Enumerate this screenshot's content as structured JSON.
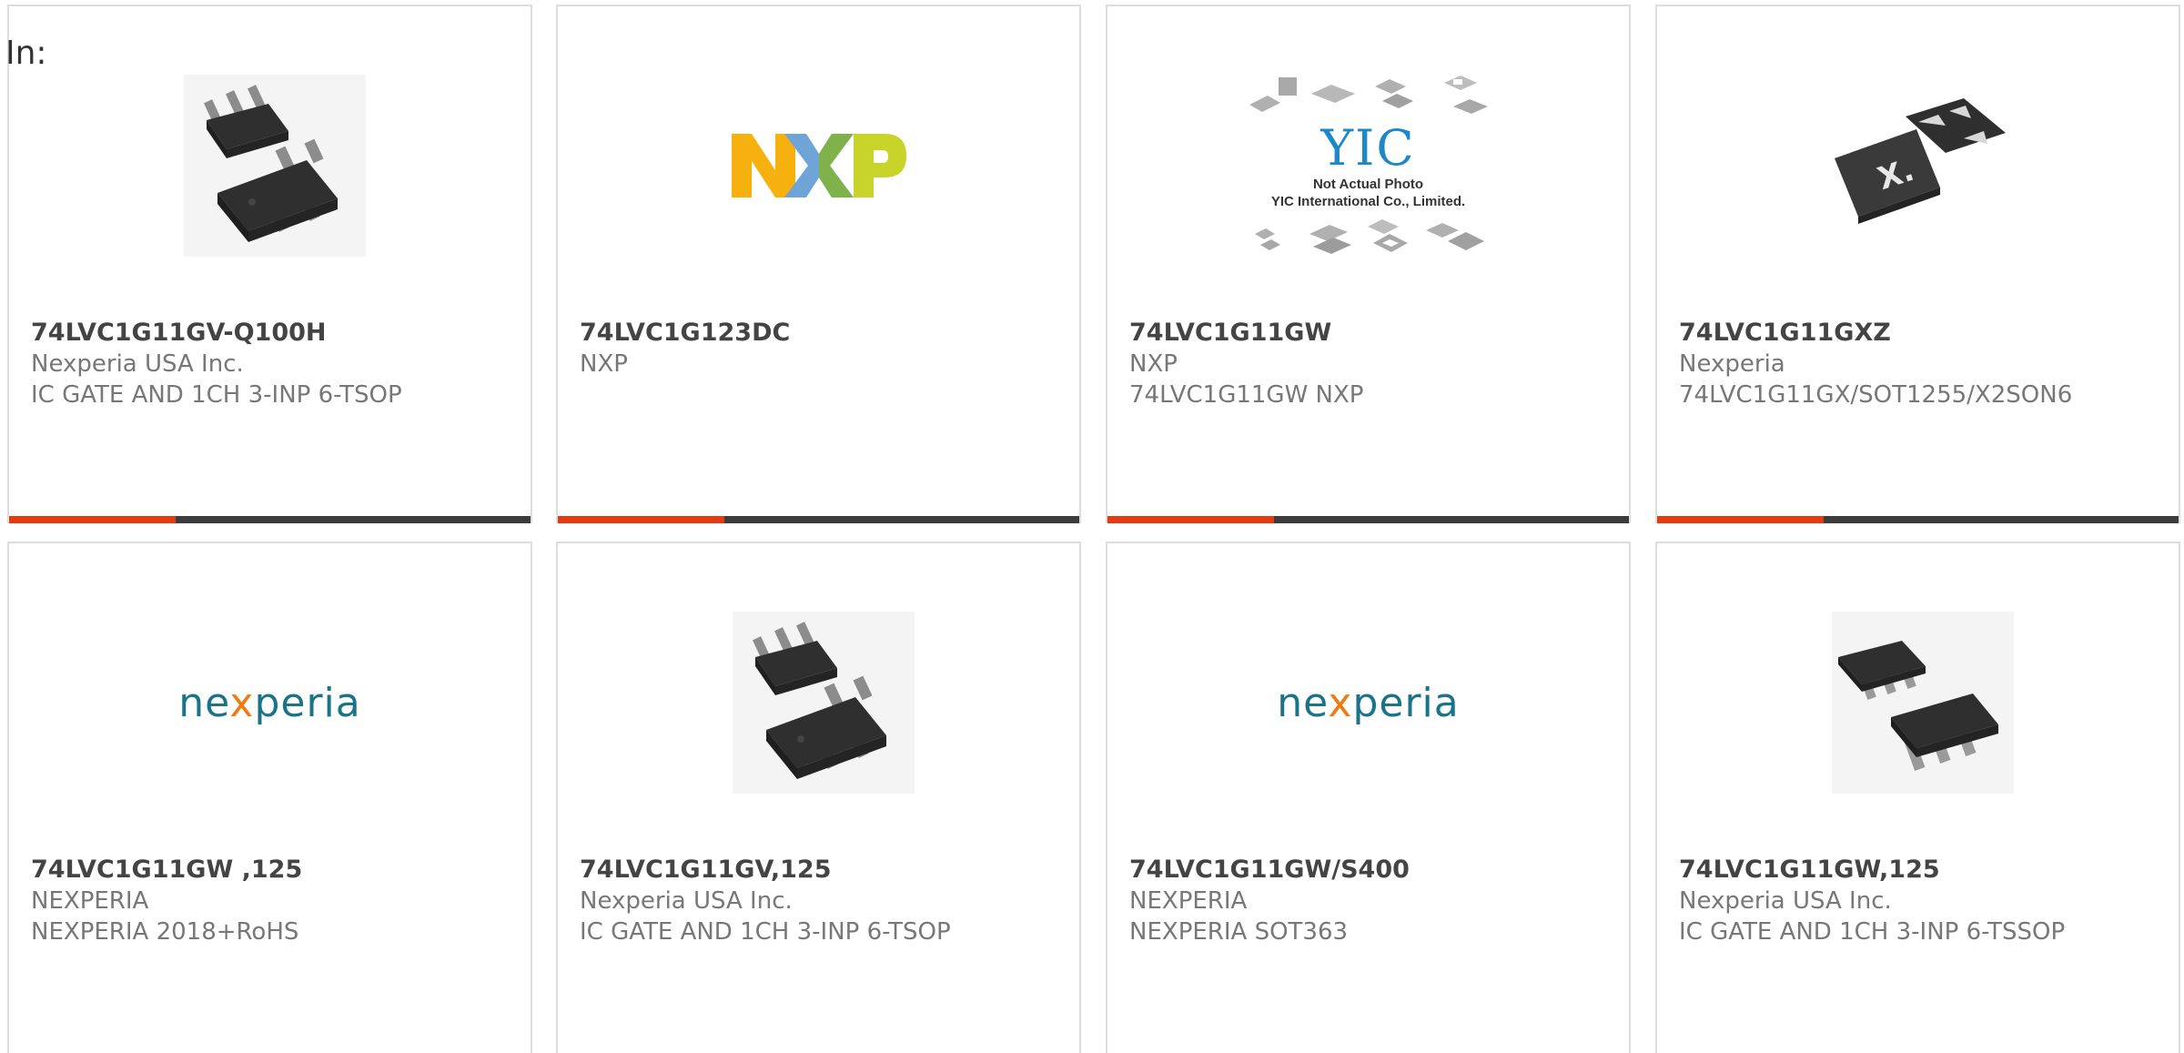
{
  "page": {
    "label": "In:"
  },
  "colors": {
    "accent_bar": "#e63a12",
    "track_bar": "#3c3c3c",
    "nexperia_teal": "#1a7489",
    "nexperia_orange": "#f07b12"
  },
  "products": [
    {
      "part": "74LVC1G11GV-Q100H",
      "manufacturer": "Nexperia USA Inc.",
      "description": "IC GATE AND 1CH 3-INP 6-TSOP",
      "image": "ic-sot-package-photo",
      "bar_fraction": 0.32
    },
    {
      "part": "74LVC1G123DC",
      "manufacturer": "NXP",
      "description": "",
      "image": "nxp-logo",
      "logo_text": "NXP",
      "bar_fraction": 0.32
    },
    {
      "part": "74LVC1G11GW",
      "manufacturer": "NXP",
      "description": "74LVC1G11GW NXP",
      "image": "yic-placeholder",
      "logo_text": "YIC",
      "caption_line1": "Not Actual Photo",
      "caption_line2": "YIC International Co., Limited.",
      "bar_fraction": 0.32
    },
    {
      "part": "74LVC1G11GXZ",
      "manufacturer": "Nexperia",
      "description": "74LVC1G11GX/SOT1255/X2SON6",
      "image": "x2son-package-photo",
      "logo_text": "X.",
      "bar_fraction": 0.32
    },
    {
      "part": "74LVC1G11GW ,125",
      "manufacturer": "NEXPERIA",
      "description": "NEXPERIA 2018+RoHS",
      "image": "nexperia-logo",
      "logo_text": "nexperia",
      "bar_fraction": 0.32
    },
    {
      "part": "74LVC1G11GV,125",
      "manufacturer": "Nexperia USA Inc.",
      "description": "IC GATE AND 1CH 3-INP 6-TSOP",
      "image": "ic-sot-package-photo",
      "bar_fraction": 0.32
    },
    {
      "part": "74LVC1G11GW/S400",
      "manufacturer": "NEXPERIA",
      "description": "NEXPERIA SOT363",
      "image": "nexperia-logo",
      "logo_text": "nexperia",
      "bar_fraction": 0.32
    },
    {
      "part": "74LVC1G11GW,125",
      "manufacturer": "Nexperia USA Inc.",
      "description": "IC GATE AND 1CH 3-INP 6-TSSOP",
      "image": "ic-tssop-package-photo",
      "bar_fraction": 0.32
    }
  ]
}
